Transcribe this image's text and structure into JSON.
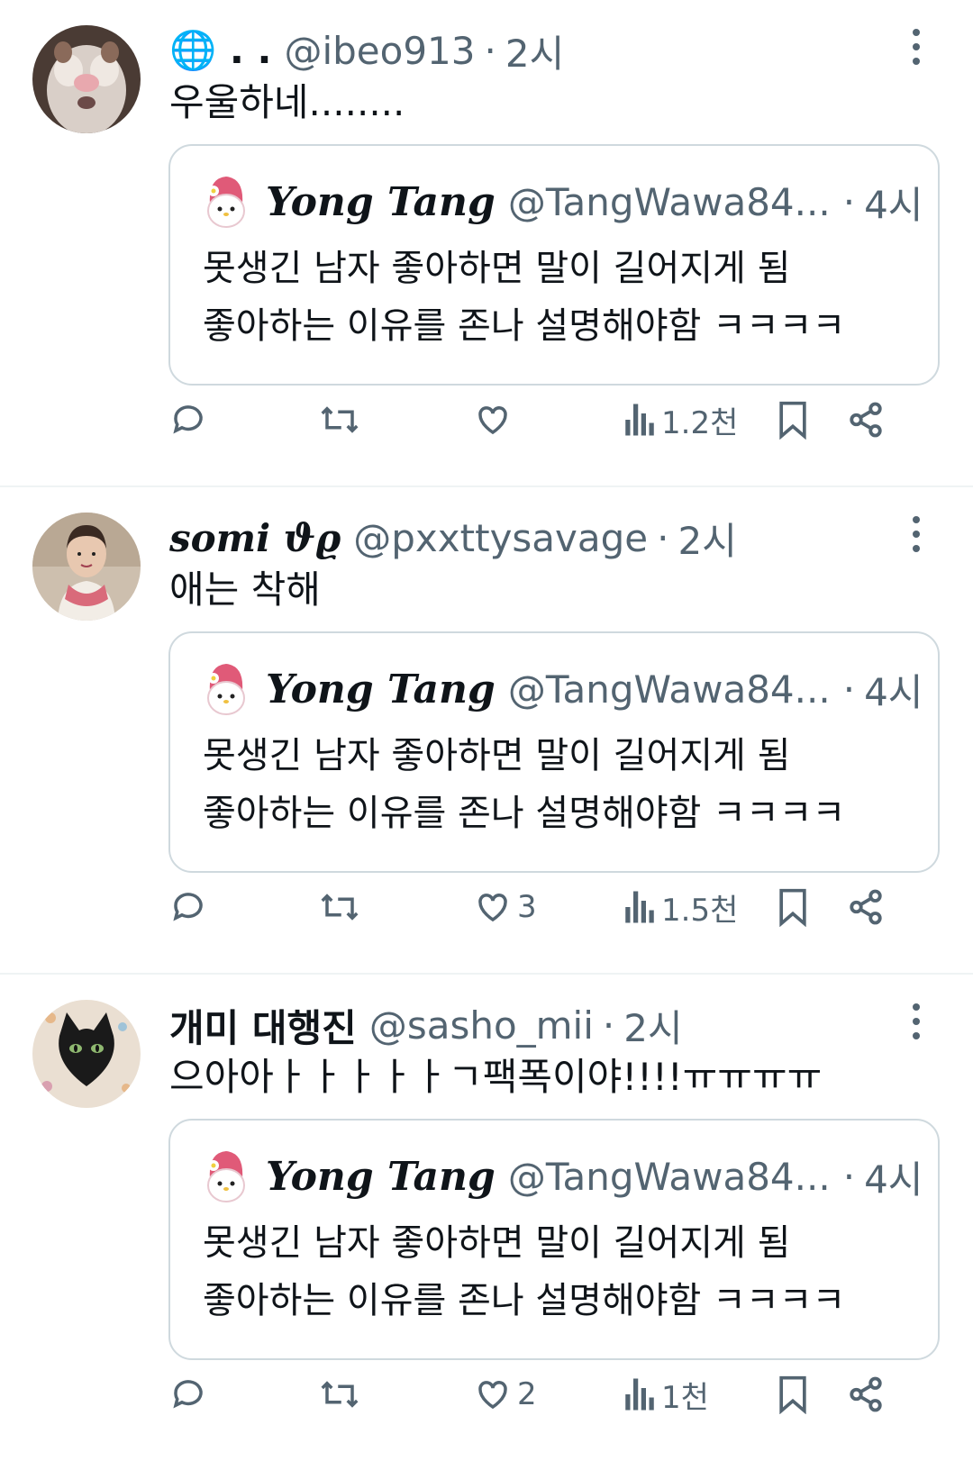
{
  "tweets": [
    {
      "display_name": "🌐 . .",
      "handle": "@ibeo913",
      "time": "2시",
      "text": "우울하네........",
      "quote": {
        "name": "Yong Tang",
        "handle": "@TangWawa84...",
        "time": "4시",
        "line1": "못생긴 남자 좋아하면 말이 길어지게 됨",
        "line2": "좋아하는 이유를 존나 설명해야함 ㅋㅋㅋㅋ"
      },
      "actions": {
        "replies": "",
        "retweets": "",
        "likes": "",
        "views": "1.2천"
      }
    },
    {
      "display_name": "somi ϑϱ",
      "handle": "@pxxttysavage",
      "time": "2시",
      "text": "애는 착해",
      "quote": {
        "name": "Yong Tang",
        "handle": "@TangWawa84...",
        "time": "4시",
        "line1": "못생긴 남자 좋아하면 말이 길어지게 됨",
        "line2": "좋아하는 이유를 존나 설명해야함 ㅋㅋㅋㅋ"
      },
      "actions": {
        "replies": "",
        "retweets": "",
        "likes": "3",
        "views": "1.5천"
      }
    },
    {
      "display_name": "개미 대행진",
      "handle": "@sasho_mii",
      "time": "2시",
      "text": "으아아ㅏㅏㅏㅏㅏㄱ팩폭이야!!!!ㅠㅠㅠㅠ",
      "quote": {
        "name": "Yong Tang",
        "handle": "@TangWawa84...",
        "time": "4시",
        "line1": "못생긴 남자 좋아하면 말이 길어지게 됨",
        "line2": "좋아하는 이유를 존나 설명해야함 ㅋㅋㅋㅋ"
      },
      "actions": {
        "replies": "",
        "retweets": "",
        "likes": "2",
        "views": "1천"
      }
    }
  ],
  "separator": "·",
  "colors": {
    "text": "#0f1419",
    "secondary": "#536471",
    "border": "#cfd9de",
    "divider": "#eff3f4"
  }
}
